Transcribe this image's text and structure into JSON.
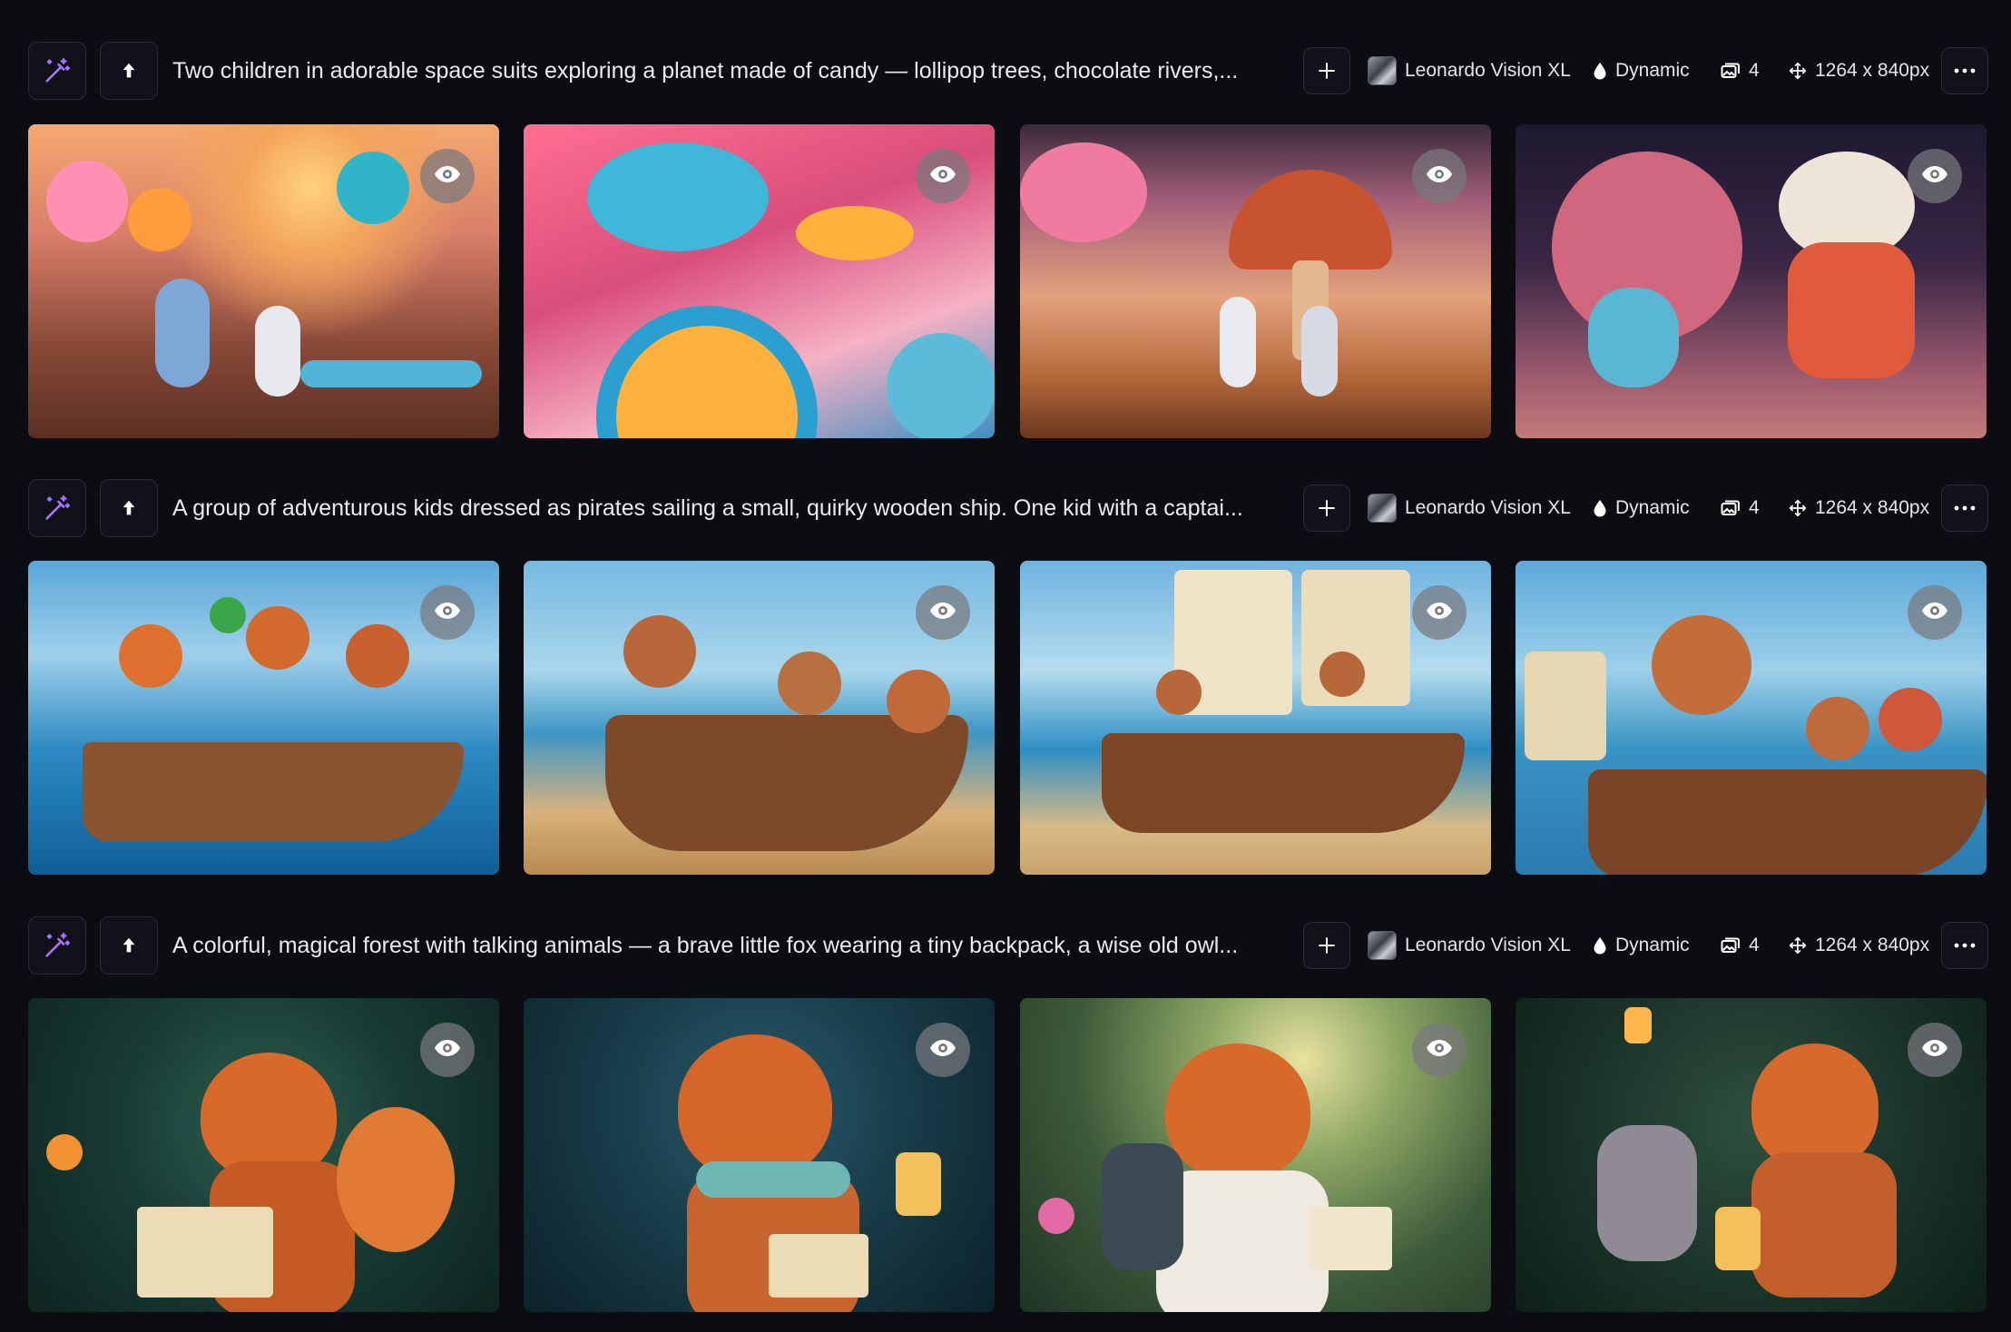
{
  "feed": {
    "generations": [
      {
        "prompt": "Two children in adorable space suits exploring a planet made of candy — lollipop trees, chocolate rivers,...",
        "model": "Leonardo Vision XL",
        "style": "Dynamic",
        "image_count": "4",
        "dimensions": "1264 x 840px",
        "images": [
          {
            "alt": "Two astronaut children standing by a candy river with lollipop trees under a pink sky"
          },
          {
            "alt": "Close-up of colorful candy planet landscape with swirl lollipops and mushrooms"
          },
          {
            "alt": "Two astronauts walking between giant candy mushrooms"
          },
          {
            "alt": "Cute blue robot and candy creature in front of a pink planet"
          }
        ]
      },
      {
        "prompt": "A group of adventurous kids dressed as pirates sailing a small, quirky wooden ship. One kid with a captai...",
        "model": "Leonardo Vision XL",
        "style": "Dynamic",
        "image_count": "4",
        "dimensions": "1264 x 840px",
        "images": [
          {
            "alt": "Pirate kids with a parrot in a wooden boat on blue waves"
          },
          {
            "alt": "Pirate kids leaning over the side of a wooden ship near a tropical beach"
          },
          {
            "alt": "Pirate kids on a sailing ship with large sails"
          },
          {
            "alt": "Pirate captain kid with a telescope and crew in a wooden boat"
          }
        ]
      },
      {
        "prompt": "A colorful, magical forest with talking animals — a brave little fox wearing a tiny backpack, a wise old owl...",
        "model": "Leonardo Vision XL",
        "style": "Dynamic",
        "image_count": "4",
        "dimensions": "1264 x 840px",
        "images": [
          {
            "alt": "Fox with backpack reading a map in a glowing forest"
          },
          {
            "alt": "Fox with glasses and scarf reading a book beside a lantern"
          },
          {
            "alt": "Fox with glasses holding a book in a sunlit forest path"
          },
          {
            "alt": "Fox with glasses and a small squirrel holding a lantern"
          }
        ]
      }
    ]
  },
  "colors": {
    "background": "#0c0d12",
    "button_border": "#2a2c36",
    "accent_purple": "#a874ff",
    "text": "#e9eaef"
  },
  "icons": {
    "remix": "magic-wand-icon",
    "upscale": "arrow-up-icon",
    "add": "plus-icon",
    "style": "droplet-icon",
    "count": "images-icon",
    "dimensions": "move-arrows-icon",
    "more": "ellipsis-icon",
    "view": "eye-icon"
  }
}
